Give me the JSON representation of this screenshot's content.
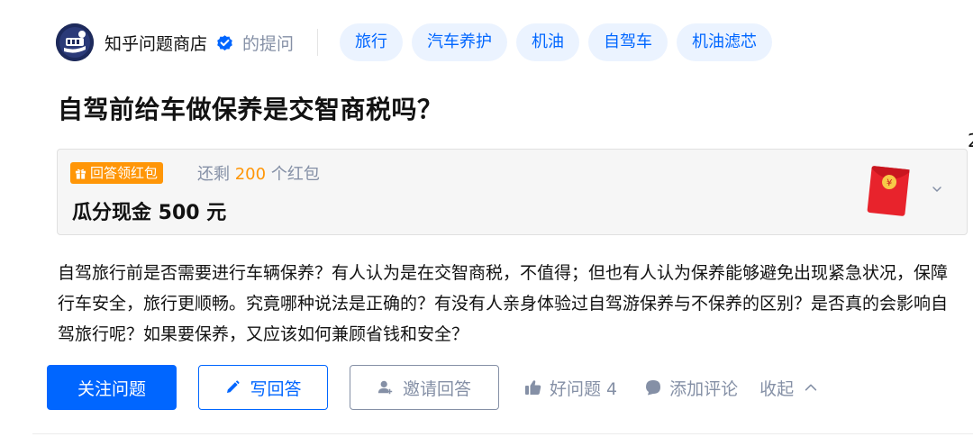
{
  "header": {
    "asker_name": "知乎问题商店",
    "asked_label": "的提问",
    "tags": [
      "旅行",
      "汽车养护",
      "机油",
      "自驾车",
      "机油滤芯"
    ]
  },
  "question": {
    "title": "自驾前给车做保养是交智商税吗？",
    "description": "自驾旅行前是否需要进行车辆保养？有人认为是在交智商税，不值得；但也有人认为保养能够避免出现紧急状况，保障行车安全，旅行更顺畅。究竟哪种说法是正确的？有没有人亲身体验过自驾游保养与不保养的区别？是否真的会影响自驾旅行呢？如果要保养，又应该如何兼顾省钱和安全？"
  },
  "reward": {
    "badge_label": "回答领红包",
    "remain_prefix": "还剩",
    "remain_count": "200",
    "remain_suffix": "个红包",
    "title": "瓜分现金 500 元",
    "edge_number": "2"
  },
  "actions": {
    "follow_label": "关注问题",
    "write_label": "写回答",
    "invite_label": "邀请回答",
    "good_question_label": "好问题 4",
    "comment_label": "添加评论",
    "collapse_label": "收起"
  },
  "icons": {
    "avatar": "avatar-logo-icon",
    "verified": "verified-badge-icon",
    "gift": "gift-icon",
    "envelope": "red-envelope-icon",
    "chevron_down": "chevron-down-icon",
    "pencil": "pencil-icon",
    "invite": "add-person-icon",
    "thumbs_up": "thumbs-up-icon",
    "comment": "comment-bubble-icon",
    "chevron_up": "chevron-up-icon"
  },
  "colors": {
    "brand_blue": "#0066ff",
    "tag_bg": "#ebf3ff",
    "reward_orange": "#ff9607",
    "muted_gray": "#8590a6",
    "envelope_red": "#e8232c"
  }
}
